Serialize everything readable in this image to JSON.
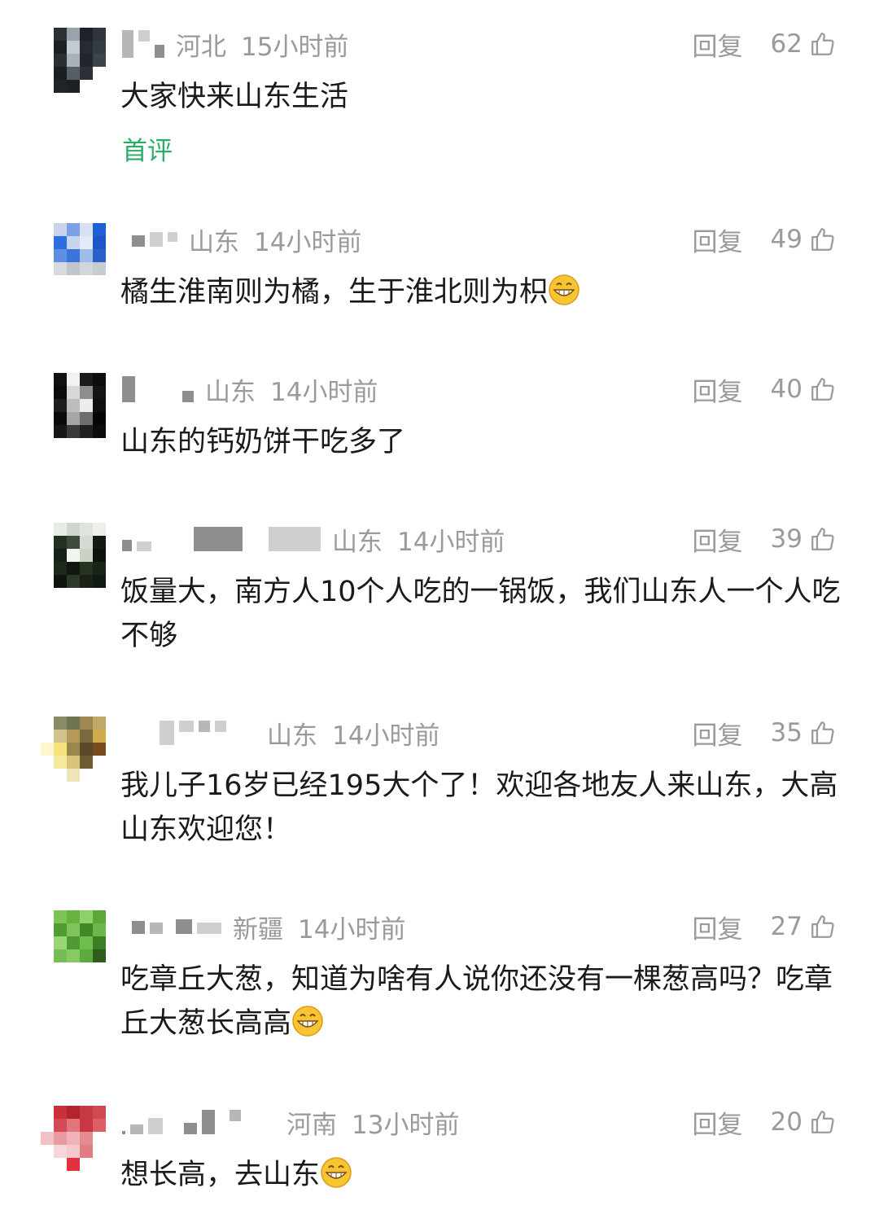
{
  "comments": [
    {
      "region": "河北",
      "time": "15小时前",
      "reply": "回复",
      "likes": "62",
      "text": "大家快来山东生活",
      "badge": "首评"
    },
    {
      "region": "山东",
      "time": "14小时前",
      "reply": "回复",
      "likes": "49",
      "text": "橘生淮南则为橘，生于淮北则为枳"
    },
    {
      "region": "山东",
      "time": "14小时前",
      "reply": "回复",
      "likes": "40",
      "text": "山东的钙奶饼干吃多了"
    },
    {
      "region": "山东",
      "time": "14小时前",
      "reply": "回复",
      "likes": "39",
      "text": "饭量大，南方人10个人吃的一锅饭，我们山东人一个人吃不够"
    },
    {
      "region": "山东",
      "time": "14小时前",
      "reply": "回复",
      "likes": "35",
      "text": "我儿子16岁已经195大个了！欢迎各地友人来山东，大高山东欢迎您！"
    },
    {
      "region": "新疆",
      "time": "14小时前",
      "reply": "回复",
      "likes": "27",
      "text": "吃章丘大葱，知道为啥有人说你还没有一棵葱高吗？吃章丘大葱长高高"
    },
    {
      "region": "河南",
      "time": "13小时前",
      "reply": "回复",
      "likes": "20",
      "text": "想长高，去山东"
    }
  ],
  "icons": {
    "like": "thumbs-up-icon",
    "emoji": "grinning-face-icon"
  },
  "colors": {
    "meta": "#9a9a9a",
    "text": "#1a1a1a",
    "badge": "#2aae67"
  }
}
